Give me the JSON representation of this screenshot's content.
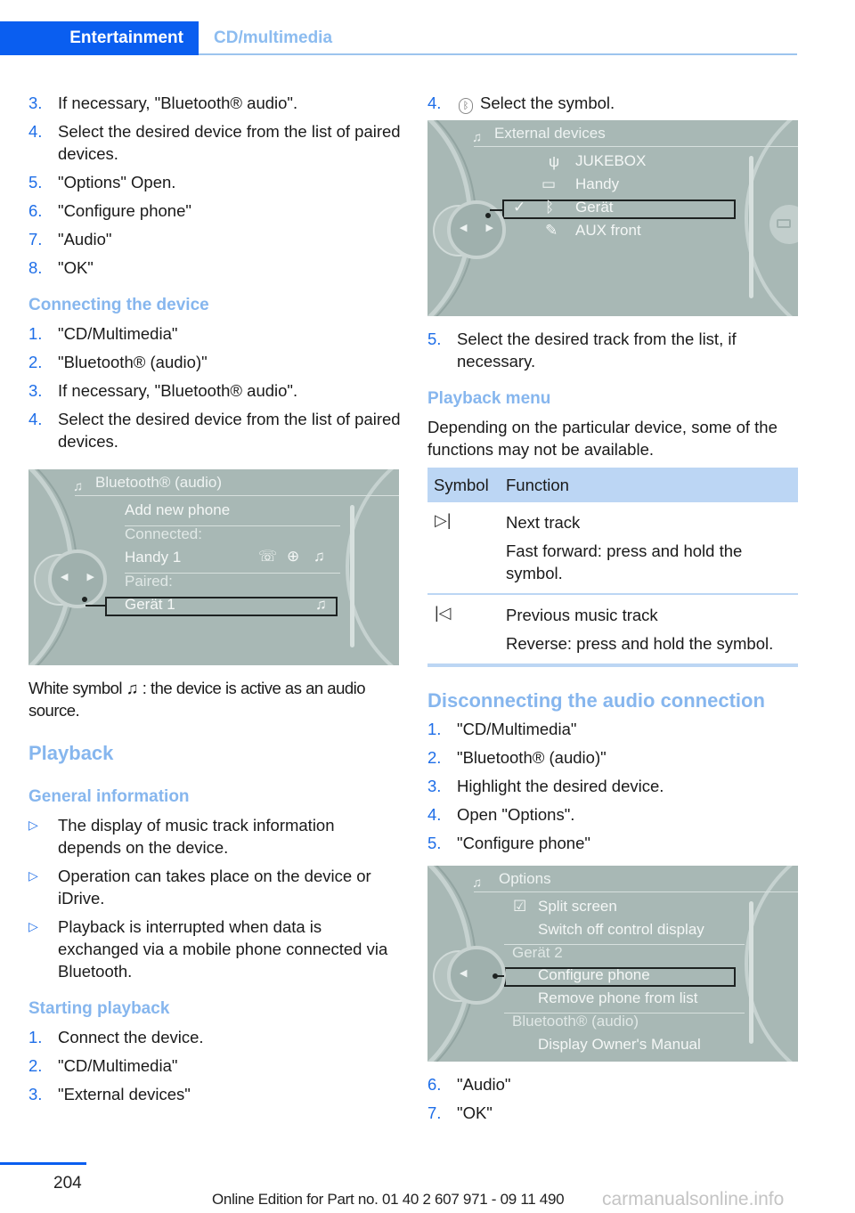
{
  "header": {
    "section": "Entertainment",
    "subsection": "CD/multimedia"
  },
  "left": {
    "steps_top": [
      {
        "n": "3.",
        "text": "If necessary, \"Bluetooth® audio\"."
      },
      {
        "n": "4.",
        "text": "Select the desired device from the list of paired devices."
      },
      {
        "n": "5.",
        "text": "\"Options\" Open."
      },
      {
        "n": "6.",
        "text": "\"Configure phone\""
      },
      {
        "n": "7.",
        "text": "\"Audio\""
      },
      {
        "n": "8.",
        "text": "\"OK\""
      }
    ],
    "connecting_heading": "Connecting the device",
    "connecting_steps": [
      {
        "n": "1.",
        "text": "\"CD/Multimedia\""
      },
      {
        "n": "2.",
        "text": "\"Bluetooth® (audio)\""
      },
      {
        "n": "3.",
        "text": "If necessary, \"Bluetooth® audio\"."
      },
      {
        "n": "4.",
        "text": "Select the desired device from the list of paired devices."
      }
    ],
    "screen_bt": {
      "title": "Bluetooth® (audio)",
      "add_new": "Add new phone",
      "connected_label": "Connected:",
      "connected_device": "Handy 1",
      "paired_label": "Paired:",
      "paired_device": "Gerät 1"
    },
    "white_symbol_pre": "White symbol",
    "white_symbol_post": ": the device is active as an audio source.",
    "playback_heading": "Playback",
    "general_heading": "General information",
    "general_bullets": [
      "The display of music track information depends on the device.",
      "Operation can takes place on the device or iDrive.",
      "Playback is interrupted when data is exchanged via a mobile phone connected via Bluetooth."
    ],
    "starting_heading": "Starting playback",
    "starting_steps": [
      {
        "n": "1.",
        "text": "Connect the device."
      },
      {
        "n": "2.",
        "text": "\"CD/Multimedia\""
      },
      {
        "n": "3.",
        "text": "\"External devices\""
      }
    ]
  },
  "right": {
    "step4": {
      "n": "4.",
      "text": "Select the symbol."
    },
    "screen_ext": {
      "title": "External devices",
      "items": [
        "JUKEBOX",
        "Handy",
        "Gerät",
        "AUX front"
      ],
      "selected_index": 2
    },
    "step5": {
      "n": "5.",
      "text": "Select the desired track from the list, if necessary."
    },
    "playback_menu_heading": "Playback menu",
    "playback_menu_intro": "Depending on the particular device, some of the functions may not be available.",
    "table": {
      "headers": [
        "Symbol",
        "Function"
      ],
      "rows": [
        {
          "symbol": "next-track-icon",
          "glyph": "▷|",
          "lines": [
            "Next track",
            "Fast forward: press and hold the symbol."
          ]
        },
        {
          "symbol": "previous-track-icon",
          "glyph": "|◁",
          "lines": [
            "Previous music track",
            "Reverse: press and hold the symbol."
          ]
        }
      ]
    },
    "disconnect_heading": "Disconnecting the audio connection",
    "disconnect_steps": [
      {
        "n": "1.",
        "text": "\"CD/Multimedia\""
      },
      {
        "n": "2.",
        "text": "\"Bluetooth® (audio)\""
      },
      {
        "n": "3.",
        "text": "Highlight the desired device."
      },
      {
        "n": "4.",
        "text": "Open \"Options\"."
      },
      {
        "n": "5.",
        "text": "\"Configure phone\""
      }
    ],
    "screen_opt": {
      "title": "Options",
      "split_screen": "Split screen",
      "switch_off": "Switch off control display",
      "device_label": "Gerät 2",
      "configure": "Configure phone",
      "remove": "Remove phone from list",
      "bt_label": "Bluetooth® (audio)",
      "manual": "Display Owner's Manual"
    },
    "final_steps": [
      {
        "n": "6.",
        "text": "\"Audio\""
      },
      {
        "n": "7.",
        "text": "\"OK\""
      }
    ]
  },
  "footer": {
    "page_number": "204",
    "edition": "Online Edition for Part no. 01 40 2 607 971 - 09 11 490",
    "watermark": "carmanualsonline.info"
  },
  "colors": {
    "brand_blue": "#0a5ef0",
    "heading_blue": "#86b6ee",
    "number_blue": "#1e6ee8",
    "table_header": "#bcd6f4",
    "screen_bg": "#a8b8b5"
  }
}
